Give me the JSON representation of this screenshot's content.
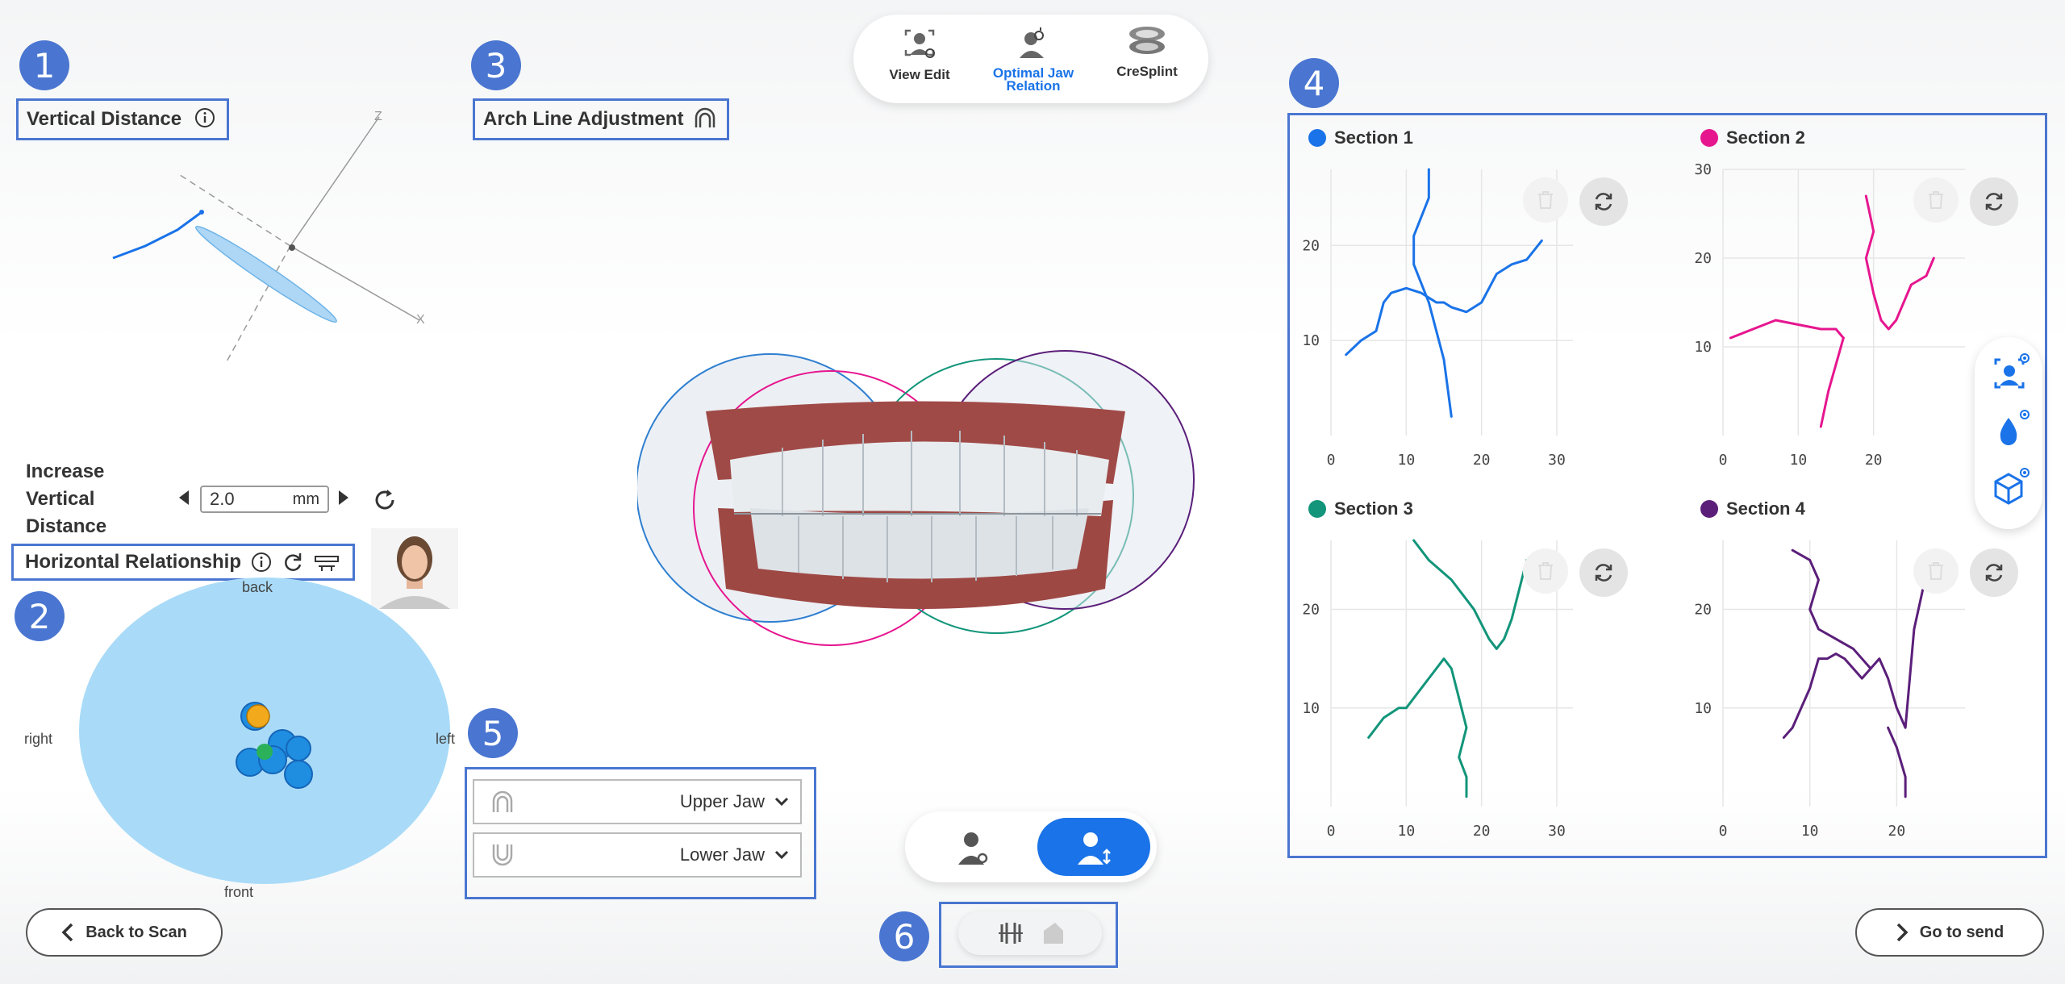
{
  "badges": [
    "1",
    "2",
    "3",
    "4",
    "5",
    "6"
  ],
  "vertical_distance": {
    "label": "Vertical Distance",
    "axis_z": "Z",
    "axis_x": "X"
  },
  "increase": {
    "label_l1": "Increase",
    "label_l2": "Vertical",
    "label_l3": "Distance",
    "value": "2.0",
    "unit": "mm"
  },
  "horizontal": {
    "label": "Horizontal Relationship",
    "back": "back",
    "front": "front",
    "right": "right",
    "left": "left"
  },
  "arch": {
    "label": "Arch Line Adjustment"
  },
  "toolbar": {
    "view_edit": "View Edit",
    "optimal_l1": "Optimal Jaw",
    "optimal_l2": "Relation",
    "cresplint": "CreSplint",
    "active_color": "#1a73e8"
  },
  "jaws": {
    "upper": "Upper Jaw",
    "lower": "Lower Jaw"
  },
  "nav": {
    "back": "Back to Scan",
    "send": "Go to send"
  },
  "sections": [
    {
      "name": "Section 1",
      "color": "#1a73e8"
    },
    {
      "name": "Section 2",
      "color": "#e6168f"
    },
    {
      "name": "Section 3",
      "color": "#12957a"
    },
    {
      "name": "Section 4",
      "color": "#5b1f7a"
    }
  ],
  "chart_data": [
    {
      "type": "line",
      "title": "Section 1",
      "x_ticks": [
        "0",
        "10",
        "20",
        "30"
      ],
      "y_ticks": [
        "10",
        "20"
      ],
      "xlim": [
        0,
        30
      ],
      "ylim": [
        0,
        28
      ],
      "series": [
        {
          "x": [
            2,
            4,
            6,
            7,
            8,
            10,
            12,
            14,
            15,
            16,
            18,
            20,
            22,
            24,
            26,
            28
          ],
          "y": [
            8.5,
            10,
            11,
            14,
            15,
            15.5,
            15,
            14,
            14,
            13.5,
            13,
            14,
            17,
            18,
            18.5,
            20.5
          ]
        },
        {
          "x": [
            13,
            13,
            12,
            11,
            11,
            12,
            13,
            14,
            15,
            16
          ],
          "y": [
            28,
            25,
            23,
            21,
            18,
            16,
            14,
            11,
            8,
            2
          ]
        }
      ]
    },
    {
      "type": "line",
      "title": "Section 2",
      "x_ticks": [
        "0",
        "10",
        "20"
      ],
      "y_ticks": [
        "10",
        "20",
        "30"
      ],
      "xlim": [
        0,
        30
      ],
      "ylim": [
        0,
        30
      ],
      "series": [
        {
          "x": [
            1,
            4,
            7,
            10,
            13,
            15,
            16
          ],
          "y": [
            11,
            12,
            13,
            12.5,
            12,
            12,
            11
          ]
        },
        {
          "x": [
            16,
            15,
            14,
            13
          ],
          "y": [
            11,
            8,
            5,
            1
          ]
        },
        {
          "x": [
            19,
            20,
            19,
            20,
            21,
            22,
            23,
            25,
            27,
            28
          ],
          "y": [
            27,
            23,
            20,
            16,
            13,
            12,
            13,
            17,
            18,
            20
          ]
        }
      ]
    },
    {
      "type": "line",
      "title": "Section 3",
      "x_ticks": [
        "0",
        "10",
        "20",
        "30"
      ],
      "y_ticks": [
        "10",
        "20"
      ],
      "xlim": [
        0,
        30
      ],
      "ylim": [
        0,
        27
      ],
      "series": [
        {
          "x": [
            5,
            7,
            9,
            10,
            12,
            14,
            15,
            16,
            17,
            18,
            17,
            18,
            18
          ],
          "y": [
            7,
            9,
            10,
            10,
            12,
            14,
            15,
            14,
            11,
            8,
            5,
            3,
            1
          ]
        },
        {
          "x": [
            11,
            13,
            16,
            18,
            19,
            21,
            22,
            23,
            24,
            25,
            26
          ],
          "y": [
            27,
            25,
            23,
            21,
            20,
            17,
            16,
            17,
            19,
            22,
            25
          ]
        }
      ]
    },
    {
      "type": "line",
      "title": "Section 4",
      "x_ticks": [
        "0",
        "10",
        "20"
      ],
      "y_ticks": [
        "10",
        "20"
      ],
      "xlim": [
        0,
        26
      ],
      "ylim": [
        0,
        27
      ],
      "series": [
        {
          "x": [
            7,
            8,
            9,
            10,
            11,
            12,
            13,
            14,
            15,
            16,
            17,
            18,
            19,
            20,
            21,
            22,
            23
          ],
          "y": [
            7,
            8,
            10,
            12,
            15,
            15,
            15.5,
            15,
            14,
            13,
            14,
            15,
            13,
            10,
            8,
            18,
            22
          ]
        },
        {
          "x": [
            8,
            10,
            11,
            10,
            11,
            13,
            15,
            17
          ],
          "y": [
            26,
            25,
            23,
            20,
            18,
            17,
            16,
            14
          ]
        },
        {
          "x": [
            19,
            20,
            21,
            21
          ],
          "y": [
            8,
            6,
            3,
            1
          ]
        }
      ]
    }
  ]
}
